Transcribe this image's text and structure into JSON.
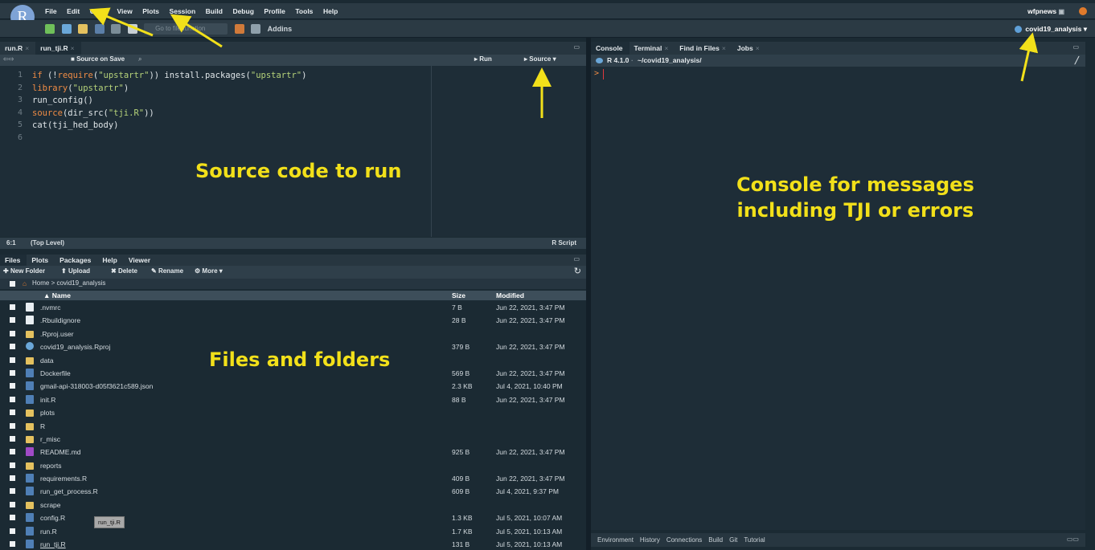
{
  "menubar": {
    "items": [
      "File",
      "Edit",
      "Code",
      "View",
      "Plots",
      "Session",
      "Build",
      "Debug",
      "Profile",
      "Tools",
      "Help"
    ],
    "user": "wfpnews"
  },
  "toolbar": {
    "goto_placeholder": "Go to file/function",
    "addins_label": "Addins",
    "project": "covid19_analysis"
  },
  "source": {
    "tabs": [
      {
        "label": "run.R",
        "active": false
      },
      {
        "label": "run_tji.R",
        "active": true
      }
    ],
    "source_on_save": "Source on Save",
    "run_label": "Run",
    "source_label": "Source",
    "lines": [
      "if (!require(\"upstartr\")) install.packages(\"upstartr\")",
      "library(\"upstartr\")",
      "run_config()",
      "source(dir_src(\"tji.R\"))",
      "cat(tji_hed_body)",
      ""
    ],
    "line_numbers": [
      "1",
      "2",
      "3",
      "4",
      "5",
      "6"
    ],
    "status_position": "6:1",
    "status_scope": "(Top Level)",
    "status_type": "R Script"
  },
  "files": {
    "tabs": [
      "Files",
      "Plots",
      "Packages",
      "Help",
      "Viewer"
    ],
    "actions": [
      "New Folder",
      "Upload",
      "Delete",
      "Rename",
      "More"
    ],
    "breadcrumb_home": "Home",
    "breadcrumb_sep": ">",
    "breadcrumb_dir": "covid19_analysis",
    "columns": {
      "name": "Name",
      "size": "Size",
      "modified": "Modified"
    },
    "rows": [
      {
        "icon": "doc",
        "name": ".nvmrc",
        "size": "7 B",
        "modified": "Jun 22, 2021, 3:47 PM"
      },
      {
        "icon": "doc",
        "name": ".Rbuildignore",
        "size": "28 B",
        "modified": "Jun 22, 2021, 3:47 PM"
      },
      {
        "icon": "folder",
        "name": ".Rproj.user",
        "size": "",
        "modified": ""
      },
      {
        "icon": "rproj",
        "name": "covid19_analysis.Rproj",
        "size": "379 B",
        "modified": "Jun 22, 2021, 3:47 PM"
      },
      {
        "icon": "folder",
        "name": "data",
        "size": "",
        "modified": ""
      },
      {
        "icon": "rfile",
        "name": "Dockerfile",
        "size": "569 B",
        "modified": "Jun 22, 2021, 3:47 PM"
      },
      {
        "icon": "json",
        "name": "gmail-api-318003-d05f3621c589.json",
        "size": "2.3 KB",
        "modified": "Jul 4, 2021, 10:40 PM"
      },
      {
        "icon": "rfile",
        "name": "init.R",
        "size": "88 B",
        "modified": "Jun 22, 2021, 3:47 PM"
      },
      {
        "icon": "folder",
        "name": "plots",
        "size": "",
        "modified": ""
      },
      {
        "icon": "folder",
        "name": "R",
        "size": "",
        "modified": ""
      },
      {
        "icon": "folder",
        "name": "r_misc",
        "size": "",
        "modified": ""
      },
      {
        "icon": "md",
        "name": "README.md",
        "size": "925 B",
        "modified": "Jun 22, 2021, 3:47 PM"
      },
      {
        "icon": "folder",
        "name": "reports",
        "size": "",
        "modified": ""
      },
      {
        "icon": "rfile",
        "name": "requirements.R",
        "size": "409 B",
        "modified": "Jun 22, 2021, 3:47 PM"
      },
      {
        "icon": "rfile",
        "name": "run_get_process.R",
        "size": "609 B",
        "modified": "Jul 4, 2021, 9:37 PM"
      },
      {
        "icon": "folder",
        "name": "scrape",
        "size": "",
        "modified": ""
      },
      {
        "icon": "rfile",
        "name": "config.R",
        "size": "1.3 KB",
        "modified": "Jul 5, 2021, 10:07 AM"
      },
      {
        "icon": "rfile",
        "name": "run.R",
        "size": "1.7 KB",
        "modified": "Jul 5, 2021, 10:13 AM"
      },
      {
        "icon": "rfile",
        "name": "run_tji.R",
        "size": "131 B",
        "modified": "Jul 5, 2021, 10:13 AM"
      }
    ],
    "tooltip": "run_tji.R"
  },
  "console": {
    "tabs": [
      "Console",
      "Terminal",
      "Find in Files",
      "Jobs"
    ],
    "version": "R 4.1.0",
    "path": "~/covid19_analysis/",
    "prompt": ">"
  },
  "env": {
    "tabs": [
      "Environment",
      "History",
      "Connections",
      "Build",
      "Git",
      "Tutorial"
    ]
  },
  "annotations": {
    "source": "Source code to run",
    "files": "Files and folders",
    "console_line1": "Console for messages",
    "console_line2": "including TJI  or errors"
  },
  "colors": {
    "annotation": "#f2e01a",
    "keyword": "#f08c45",
    "string": "#b6d37a"
  }
}
